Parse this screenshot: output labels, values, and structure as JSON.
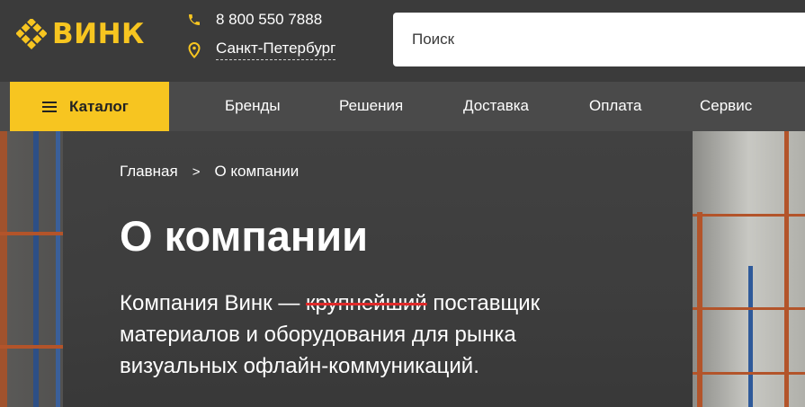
{
  "brand": {
    "name": "ВИНК",
    "accent_color": "#f7c520"
  },
  "header": {
    "phone": "8 800 550 7888",
    "city": "Санкт-Петербург",
    "search_placeholder": "Поиск",
    "phone_icon": "phone-icon",
    "location_icon": "location-pin-icon"
  },
  "nav": {
    "catalog_label": "Каталог",
    "items": [
      "Бренды",
      "Решения",
      "Доставка",
      "Оплата",
      "Сервис"
    ]
  },
  "hero": {
    "breadcrumb": {
      "home": "Главная",
      "separator": ">",
      "current": "О компании"
    },
    "title": "О компании",
    "lead": {
      "before": "Компания Винк — ",
      "struck": "крупнейший",
      "after": " поставщик материалов и оборудования для рынка визуальных офлайн-коммуникаций."
    },
    "strike_color": "#e02a2a"
  }
}
